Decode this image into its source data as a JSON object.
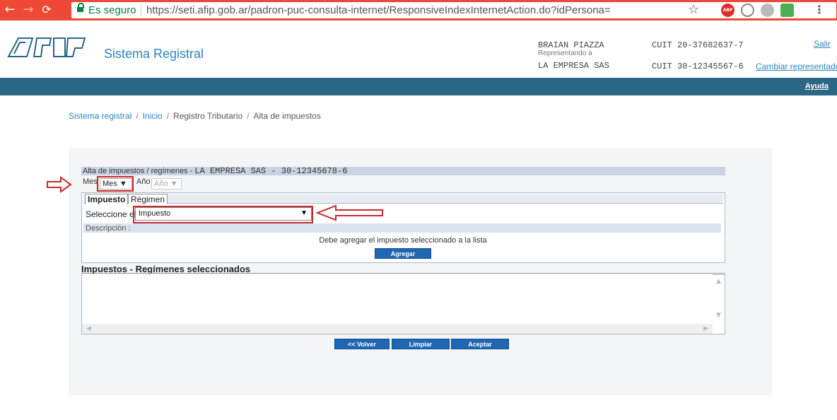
{
  "browser": {
    "secure_label": "Es seguro",
    "url": "https://seti.afip.gob.ar/padron-puc-consulta-internet/ResponsiveIndexInternetAction.do?idPersona=",
    "ext_abp_label": "ABP",
    "colors": {
      "chrome": "#ee4837",
      "secure": "#0b8043"
    }
  },
  "header": {
    "site_title": "Sistema Registral",
    "user_name": "BRAIAN PIAZZA",
    "representing_label": "Representando a",
    "company": "LA EMPRESA SAS",
    "cuit_user": "CUIT 20-37682637-7",
    "cuit_company": "CUIT 30-12345567-6",
    "salir": "Salir",
    "cambiar": "Cambiar representado",
    "ayuda": "Ayuda",
    "bar_color": "#2b6685"
  },
  "breadcrumb": {
    "item1": "Sistema registral",
    "item2": "Inicio",
    "item3": "Registro Tributario",
    "item4": "Alta de impuestos",
    "sep": "/"
  },
  "form": {
    "title_prefix": "Alta de impuestos / regímenes - ",
    "title_company": "LA EMPRESA SAS  -  30-12345678-6",
    "mes_label": "Mes",
    "mes_value": "Mes ▼",
    "anio_label": "Año",
    "anio_value": "Año ▼",
    "tab_impuesto": "Impuesto",
    "tab_regimen": "Régimen",
    "seleccione_label": "Seleccione el",
    "impuesto_value": "Impuesto",
    "descripcion_label": "Descripción :",
    "message": "Debe agregar el impuesto seleccionado a la lista",
    "agregar": "Agregar",
    "selected_title": "Impuestos - Regímenes seleccionados",
    "volver": "<< Volver",
    "limpiar": "Limpiar",
    "aceptar": "Aceptar"
  }
}
